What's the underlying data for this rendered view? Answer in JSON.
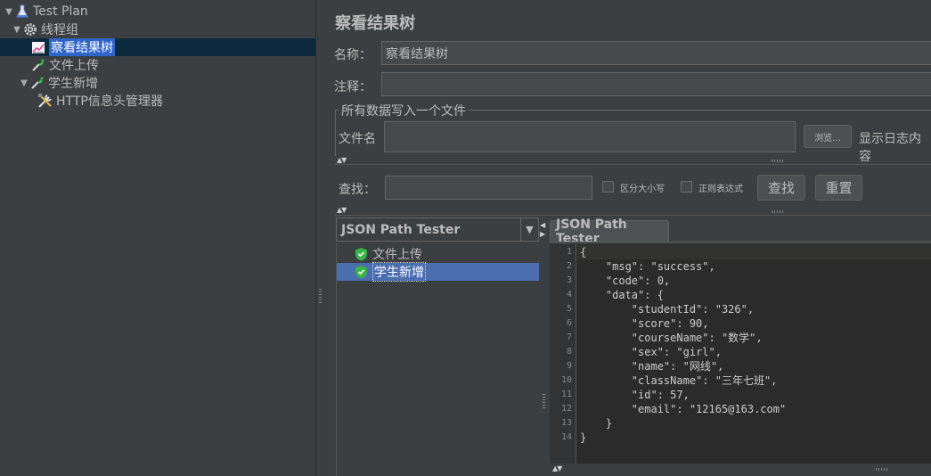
{
  "tree": {
    "test_plan": "Test Plan",
    "thread_group": "线程组",
    "view_results_tree": "察看结果树",
    "file_upload": "文件上传",
    "student_add": "学生新增",
    "http_header_manager": "HTTP信息头管理器"
  },
  "panel": {
    "title": "察看结果树",
    "name_label": "名称：",
    "name_value": "察看结果树",
    "comment_label": "注释：",
    "comment_value": "",
    "write_group_title": "所有数据写入一个文件",
    "filename_label": "文件名",
    "filename_value": "",
    "browse_button": "浏览...",
    "log_label": "显示日志内容",
    "search_label": "查找：",
    "search_value": "",
    "case_sensitive": "区分大小写",
    "regex": "正则表达式",
    "find_button": "查找",
    "reset_button": "重置"
  },
  "results": {
    "renderer": "JSON Path Tester",
    "items": [
      "文件上传",
      "学生新增"
    ],
    "selected_item": "学生新增",
    "tab_label": "JSON Path Tester"
  },
  "editor": {
    "line_numbers": [
      "1",
      "2",
      "3",
      "4",
      "5",
      "6",
      "7",
      "8",
      "9",
      "10",
      "11",
      "12",
      "13",
      "14"
    ],
    "lines": [
      "{",
      "    \"msg\": \"success\",",
      "    \"code\": 0,",
      "    \"data\": {",
      "        \"studentId\": \"326\",",
      "        \"score\": 90,",
      "        \"courseName\": \"数学\",",
      "        \"sex\": \"girl\",",
      "        \"name\": \"网线\",",
      "        \"className\": \"三年七班\",",
      "        \"id\": 57,",
      "        \"email\": \"12165@163.com\"",
      "    }",
      "}"
    ]
  },
  "colors": {
    "background": "#3c3f41",
    "selection_blue": "#4b6eaf",
    "editor_bg": "#2b2b2b",
    "success_green": "#3bb44a"
  }
}
